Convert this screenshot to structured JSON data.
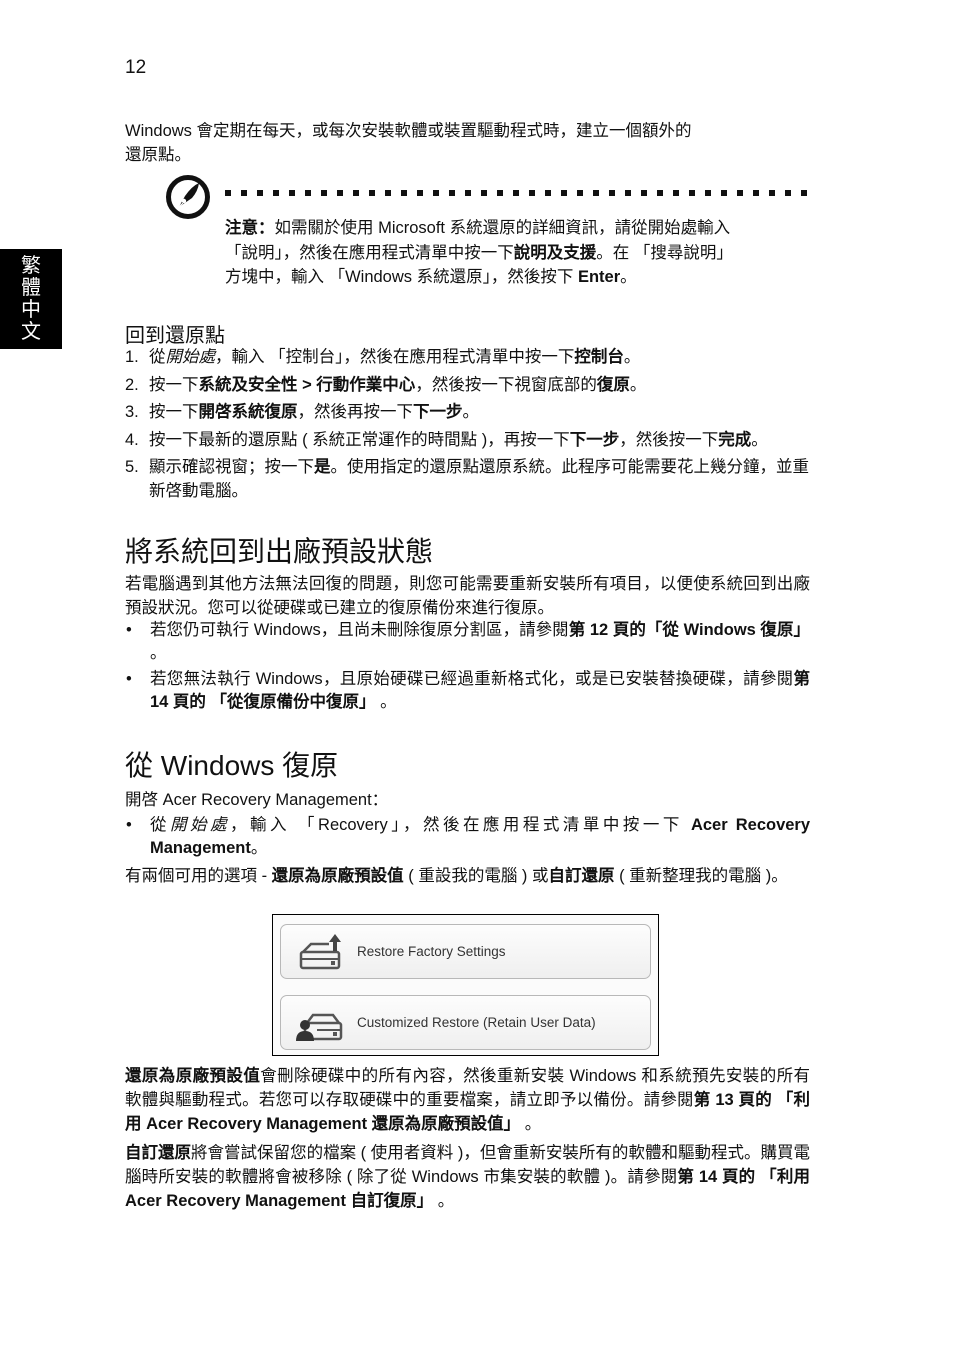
{
  "page": {
    "number": "12",
    "side_tab": [
      "繁",
      "體",
      "中",
      "文"
    ]
  },
  "intro": {
    "line1": "Windows 會定期在每天，或每次安裝軟體或裝置驅動程式時，建立一個額外的",
    "line2": "還原點。"
  },
  "note": {
    "icon": "note-pen-icon",
    "label": "注意：",
    "t1": "如需關於使用 Microsoft 系統還原的詳細資訊，請從開始處輸入",
    "t2": "「說明」，然後在應用程式清單中按一下",
    "t2_bold": "說明及支援",
    "t3": "。在 「搜尋說明」",
    "t4": "方塊中，輸入 「Windows 系統還原」，然後按下 ",
    "t4_bold": "Enter",
    "t5": "。"
  },
  "restore_point": {
    "title": "回到還原點",
    "steps": [
      {
        "num": "1.",
        "a": "從",
        "a_italic": "開始處",
        "b": "，輸入 「控制台」，然後在應用程式清單中按一下",
        "b_bold": "控制台",
        "c": "。"
      },
      {
        "num": "2.",
        "a": "按一下",
        "a_bold": "系統及安全性 > 行動作業中心",
        "b": "，然後按一下視窗底部的",
        "b_bold": "復原",
        "c": "。"
      },
      {
        "num": "3.",
        "a": "按一下",
        "a_bold": "開啓系統復原",
        "b": "，然後再按一下",
        "b_bold": "下一步",
        "c": "。"
      },
      {
        "num": "4.",
        "a": "按一下最新的還原點 ( 系統正常運作的時間點 )，再按一下",
        "a_bold": "下一步",
        "b": "，然後按一下",
        "b_bold": "完成",
        "c": "。"
      },
      {
        "num": "5.",
        "a": "顯示確認視窗；按一下",
        "a_bold": "是",
        "b": "。使用指定的還原點還原系統。此程序可能需要花上幾分鐘，並重新啓動電腦。"
      }
    ]
  },
  "factory": {
    "heading": "將系統回到出廠預設狀態",
    "para": "若電腦遇到其他方法無法回復的問題，則您可能需要重新安裝所有項目，以便使系統回到出廠預設狀況。您可以從硬碟或已建立的復原備份來進行復原。",
    "bullets": [
      {
        "a": "若您仍可執行 Windows，且尚未刪除復原分割區，請參閱",
        "a_bold": "第 12 頁的「從 Windows 復原」",
        "b": " 。"
      },
      {
        "a": "若您無法執行 Windows，且原始硬碟已經過重新格式化，或是已安裝替換硬碟，請參閱",
        "a_bold": "第 14 頁的 「從復原備份中復原」",
        "b": " 。"
      }
    ]
  },
  "from_windows": {
    "heading": "從 Windows 復原",
    "open_line": "開啓 Acer Recovery Management：",
    "bullet": {
      "a": "從",
      "a_italic": "開始處",
      "b": "，輸入 「Recovery」，然後在應用程式清單中按一下 ",
      "b_bold": "Acer Recovery Management",
      "c": "。"
    },
    "options": {
      "a": "有兩個可用的選項 - ",
      "a_bold": "還原為原廠預設值",
      "b": " ( 重設我的電腦 ) 或",
      "b_bold": "自訂還原",
      "c": " ( 重新整理我的電腦 )。"
    },
    "buttons": [
      {
        "label": "Restore Factory Settings",
        "icon": "drive-upload-icon"
      },
      {
        "label": "Customized Restore (Retain User Data)",
        "icon": "drive-user-icon"
      }
    ],
    "factory_desc": {
      "a_bold": "還原為原廠預設值",
      "b": "會刪除硬碟中的所有內容，然後重新安裝 Windows 和系統預先安裝的所有軟體與驅動程式。若您可以存取硬碟中的重要檔案，請立即予以備份。請參閱",
      "b_bold": "第 13 頁的 「利用 Acer Recovery Management 還原為原廠預設值」",
      "c": " 。"
    },
    "custom_desc": {
      "a_bold": "自訂還原",
      "b": "將會嘗試保留您的檔案 ( 使用者資料 )，但會重新安裝所有的軟體和驅動程式。購買電腦時所安裝的軟體將會被移除 ( 除了從 Windows 市集安裝的軟體 )。請參閱",
      "b_bold": "第 14 頁的 「利用 Acer Recovery Management 自訂復原」",
      "c": " 。"
    }
  }
}
